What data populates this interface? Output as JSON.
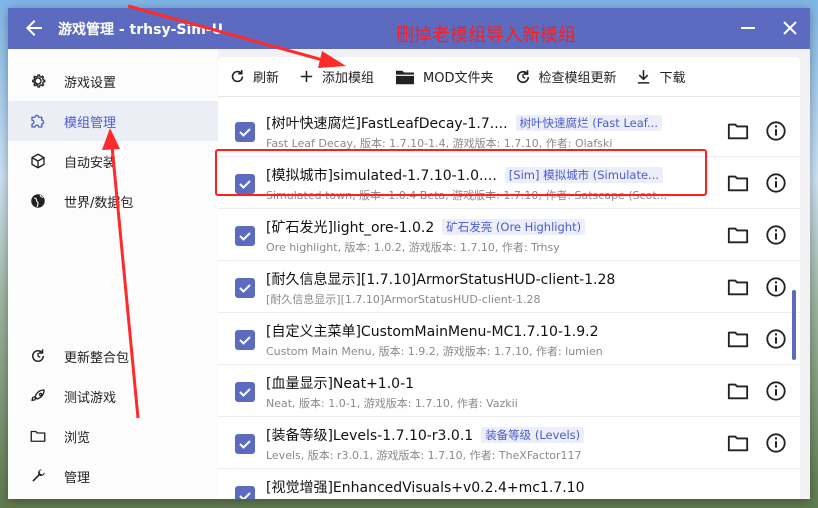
{
  "window": {
    "title": "游戏管理 - trhsy-Sim-U",
    "annotation": "删掉老模组导入新模组"
  },
  "sidebar": {
    "items": [
      {
        "label": "游戏设置",
        "icon": "gear-icon"
      },
      {
        "label": "模组管理",
        "icon": "puzzle-icon",
        "active": true
      },
      {
        "label": "自动安装",
        "icon": "cube-icon"
      },
      {
        "label": "世界/数据包",
        "icon": "globe-icon"
      },
      {
        "label": "更新整合包",
        "icon": "update-icon"
      },
      {
        "label": "测试游戏",
        "icon": "rocket-icon"
      },
      {
        "label": "浏览",
        "icon": "folder-icon"
      },
      {
        "label": "管理",
        "icon": "wrench-icon"
      }
    ]
  },
  "toolbar": {
    "refresh": "刷新",
    "add_mod": "添加模组",
    "mod_folder": "MOD文件夹",
    "check_updates": "检查模组更新",
    "download": "下载"
  },
  "mods": [
    {
      "name": "[树叶快速腐烂]FastLeafDecay-1.7....",
      "tag": "树叶快速腐烂 (Fast Leaf...",
      "desc": "Fast Leaf Decay, 版本: 1.7.10-1.4, 游戏版本: 1.7.10, 作者: Olafski",
      "checked": true
    },
    {
      "name": "[模拟城市]simulated-1.7.10-1.0....",
      "tag": "[Sim] 模拟城市 (Simulate...",
      "desc": "Simulated town, 版本: 1.0.4 Beta, 游戏版本: 1.7.10, 作者: Satscape (Scot...",
      "checked": true
    },
    {
      "name": "[矿石发光]light_ore-1.0.2",
      "tag": "矿石发亮 (Ore Highlight)",
      "desc": "Ore highlight, 版本: 1.0.2, 游戏版本: 1.7.10, 作者: Trhsy",
      "checked": true
    },
    {
      "name": "[耐久信息显示][1.7.10]ArmorStatusHUD-client-1.28",
      "tag": "",
      "desc": "[耐久信息显示][1.7.10]ArmorStatusHUD-client-1.28",
      "checked": true
    },
    {
      "name": "[自定义主菜单]CustomMainMenu-MC1.7.10-1.9.2",
      "tag": "",
      "desc": "Custom Main Menu, 版本: 1.9.2, 游戏版本: 1.7.10, 作者: lumien",
      "checked": true
    },
    {
      "name": "[血量显示]Neat+1.0-1",
      "tag": "",
      "desc": "Neat, 版本: 1.0-1, 游戏版本: 1.7.10, 作者: Vazkii",
      "checked": true
    },
    {
      "name": "[装备等级]Levels-1.7.10-r3.0.1",
      "tag": "装备等级 (Levels)",
      "desc": "Levels, 版本: r3.0.1, 游戏版本: 1.7.10, 作者: TheXFactor117",
      "checked": true
    },
    {
      "name": "[视觉增强]EnhancedVisuals+v0.2.4+mc1.7.10",
      "tag": "",
      "desc": "",
      "checked": true
    }
  ],
  "colors": {
    "accent": "#5c6bc0",
    "annotation": "#ff1c1c"
  }
}
